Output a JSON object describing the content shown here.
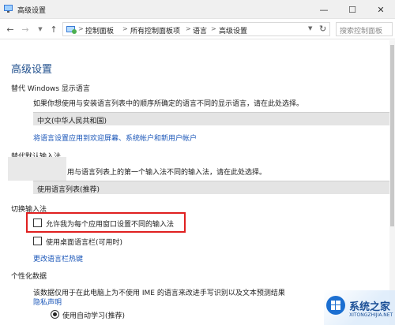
{
  "window": {
    "title": "高级设置",
    "minimize_glyph": "—",
    "maximize_glyph": "☐",
    "close_glyph": "✕"
  },
  "nav": {
    "back_glyph": "←",
    "forward_glyph": "→",
    "dropdown_glyph": "▼",
    "up_glyph": "↑",
    "breadcrumbs": [
      "控制面板",
      "所有控制面板项",
      "语言",
      "高级设置"
    ],
    "separator": ">",
    "refresh_glyph": "↻",
    "search_placeholder": "搜索控制面板"
  },
  "page": {
    "title": "高级设置",
    "display_language": {
      "heading": "替代 Windows 显示语言",
      "description": "如果你想使用与安装语言列表中的顺序所确定的语言不同的显示语言，请在此处选择。",
      "selected": "中文(中华人民共和国)",
      "link": "将语言设置应用到欢迎屏幕、系统帐户和新用户帐户"
    },
    "input_method": {
      "heading": "替代默认输入法",
      "description": "用与语言列表上的第一个输入法不同的输入法，请在此处选择。",
      "selected": "使用语言列表(推荐)"
    },
    "switching": {
      "heading": "切换输入法",
      "per_app_label": "允许我为每个应用窗口设置不同的输入法",
      "per_app_checked": false,
      "desktop_bar_label": "使用桌面语言栏(可用时)",
      "desktop_bar_checked": false,
      "hotkeys_link": "更改语言栏热键"
    },
    "personalization": {
      "heading": "个性化数据",
      "description": "该数据仅用于在此电脑上为不使用 IME 的语言来改进手写识别以及文本预测结果",
      "privacy_link": "隐私声明",
      "radio_label": "使用自动学习(推荐)",
      "radio_selected": true
    }
  },
  "watermark": {
    "text": "系统之家",
    "sub": "XITONGZHIJIA.NET"
  },
  "colors": {
    "link": "#1a56b8",
    "title": "#1e4e8c",
    "highlight_box": "#e02020"
  },
  "icons": {
    "app": "control-panel-icon",
    "address": "control-panel-icon",
    "watermark": "windows-logo-icon"
  }
}
